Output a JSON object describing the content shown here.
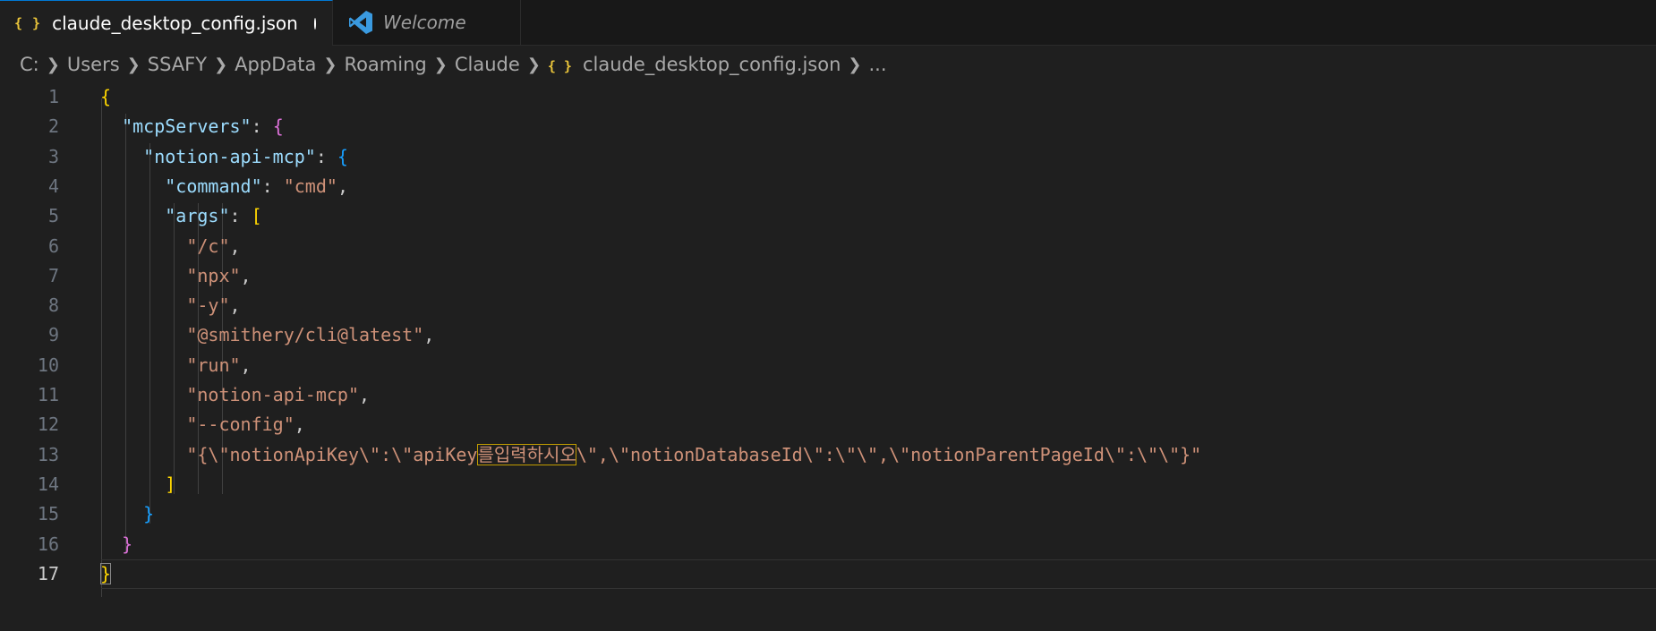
{
  "tabs": [
    {
      "label": "claude_desktop_config.json",
      "icon": "json-braces-icon",
      "active": true,
      "dirty": true
    },
    {
      "label": "Welcome",
      "icon": "vscode-icon",
      "active": false
    }
  ],
  "breadcrumb": {
    "items": [
      "C:",
      "Users",
      "SSAFY",
      "AppData",
      "Roaming",
      "Claude",
      "claude_desktop_config.json",
      "..."
    ],
    "separator": ">",
    "file_icon": "{}"
  },
  "editor": {
    "lines": [
      {
        "no": "1",
        "tokens": [
          [
            "b1",
            "{"
          ]
        ]
      },
      {
        "no": "2",
        "tokens": [
          [
            "p",
            "  "
          ],
          [
            "k",
            "\"mcpServers\""
          ],
          [
            "p",
            ": "
          ],
          [
            "b2",
            "{"
          ]
        ]
      },
      {
        "no": "3",
        "tokens": [
          [
            "p",
            "    "
          ],
          [
            "k",
            "\"notion-api-mcp\""
          ],
          [
            "p",
            ": "
          ],
          [
            "b3",
            "{"
          ]
        ]
      },
      {
        "no": "4",
        "tokens": [
          [
            "p",
            "      "
          ],
          [
            "k",
            "\"command\""
          ],
          [
            "p",
            ": "
          ],
          [
            "s",
            "\"cmd\""
          ],
          [
            "p",
            ","
          ]
        ]
      },
      {
        "no": "5",
        "tokens": [
          [
            "p",
            "      "
          ],
          [
            "k",
            "\"args\""
          ],
          [
            "p",
            ": "
          ],
          [
            "b1",
            "["
          ]
        ]
      },
      {
        "no": "6",
        "tokens": [
          [
            "p",
            "        "
          ],
          [
            "s",
            "\"/c\""
          ],
          [
            "p",
            ","
          ]
        ]
      },
      {
        "no": "7",
        "tokens": [
          [
            "p",
            "        "
          ],
          [
            "s",
            "\"npx\""
          ],
          [
            "p",
            ","
          ]
        ]
      },
      {
        "no": "8",
        "tokens": [
          [
            "p",
            "        "
          ],
          [
            "s",
            "\"-y\""
          ],
          [
            "p",
            ","
          ]
        ]
      },
      {
        "no": "9",
        "tokens": [
          [
            "p",
            "        "
          ],
          [
            "s",
            "\"@smithery/cli@latest\""
          ],
          [
            "p",
            ","
          ]
        ]
      },
      {
        "no": "10",
        "tokens": [
          [
            "p",
            "        "
          ],
          [
            "s",
            "\"run\""
          ],
          [
            "p",
            ","
          ]
        ]
      },
      {
        "no": "11",
        "tokens": [
          [
            "p",
            "        "
          ],
          [
            "s",
            "\"notion-api-mcp\""
          ],
          [
            "p",
            ","
          ]
        ]
      },
      {
        "no": "12",
        "tokens": [
          [
            "p",
            "        "
          ],
          [
            "s",
            "\"--config\""
          ],
          [
            "p",
            ","
          ]
        ]
      },
      {
        "no": "13",
        "tokens": [
          [
            "p",
            "        "
          ],
          [
            "s",
            "\"{\\\"notionApiKey\\\":\\\"apiKey"
          ],
          [
            "s hl",
            "를입력하시오"
          ],
          [
            "s",
            "\\\",\\\"notionDatabaseId\\\":\\\"\\\",\\\"notionParentPageId\\\":\\\"\\\"}\""
          ]
        ]
      },
      {
        "no": "14",
        "tokens": [
          [
            "p",
            "      "
          ],
          [
            "b1",
            "]"
          ]
        ]
      },
      {
        "no": "15",
        "tokens": [
          [
            "p",
            "    "
          ],
          [
            "b3",
            "}"
          ]
        ]
      },
      {
        "no": "16",
        "tokens": [
          [
            "p",
            "  "
          ],
          [
            "b2",
            "}"
          ]
        ]
      },
      {
        "no": "17",
        "tokens": [
          [
            "b1 hlb",
            "}"
          ]
        ]
      }
    ],
    "active_line": "17"
  }
}
